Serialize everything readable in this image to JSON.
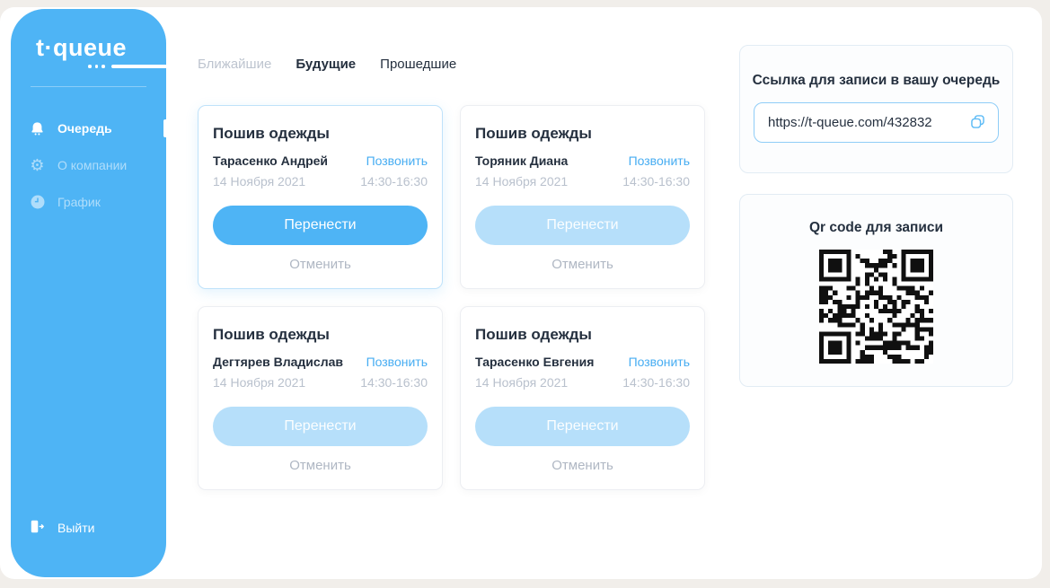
{
  "app": {
    "logo_text": "t·queue"
  },
  "sidebar": {
    "items": [
      {
        "label": "Очередь",
        "icon": "queue-bell-icon",
        "active": true
      },
      {
        "label": "О компании",
        "icon": "gear-icon",
        "active": false
      },
      {
        "label": "График",
        "icon": "clock-icon",
        "active": false
      }
    ],
    "logout_label": "Выйти"
  },
  "tabs": [
    {
      "label": "Ближайшие",
      "state": "dimmed"
    },
    {
      "label": "Будущие",
      "state": "active"
    },
    {
      "label": "Прошедшие",
      "state": "default"
    }
  ],
  "cards": [
    {
      "service": "Пошив одежды",
      "client": "Тарасенко Андрей",
      "call_label": "Позвонить",
      "date": "14 Ноября 2021",
      "time": "14:30-16:30",
      "reschedule_label": "Перенести",
      "cancel_label": "Отменить",
      "reschedule_enabled": true,
      "highlighted": true
    },
    {
      "service": "Пошив одежды",
      "client": "Торяник Диана",
      "call_label": "Позвонить",
      "date": "14 Ноября 2021",
      "time": "14:30-16:30",
      "reschedule_label": "Перенести",
      "cancel_label": "Отменить",
      "reschedule_enabled": false,
      "highlighted": false
    },
    {
      "service": "Пошив одежды",
      "client": "Дегтярев Владислав",
      "call_label": "Позвонить",
      "date": "14 Ноября 2021",
      "time": "14:30-16:30",
      "reschedule_label": "Перенести",
      "cancel_label": "Отменить",
      "reschedule_enabled": false,
      "highlighted": false
    },
    {
      "service": "Пошив одежды",
      "client": "Тарасенко Евгения",
      "call_label": "Позвонить",
      "date": "14 Ноября 2021",
      "time": "14:30-16:30",
      "reschedule_label": "Перенести",
      "cancel_label": "Отменить",
      "reschedule_enabled": false,
      "highlighted": false
    }
  ],
  "link_panel": {
    "title": "Ссылка для записи в вашу очередь",
    "url": "https://t-queue.com/432832",
    "copy_icon": "copy-icon"
  },
  "qr_panel": {
    "title": "Qr code для записи"
  },
  "colors": {
    "primary": "#4EB4F5",
    "primary_disabled": "#B6DFFA",
    "link": "#47ADF2",
    "text_dark": "#25303F",
    "text_muted": "#B9C1CD"
  }
}
